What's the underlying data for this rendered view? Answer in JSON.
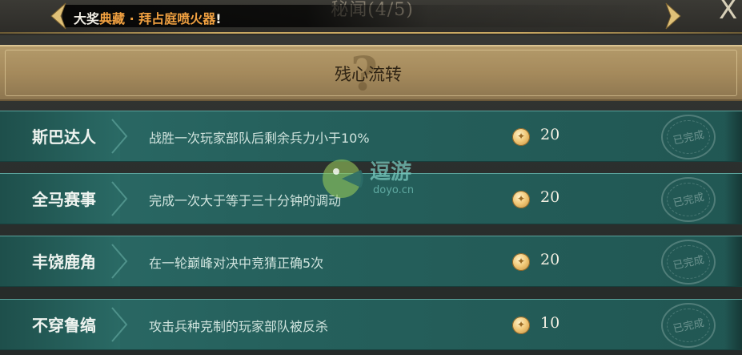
{
  "header": {
    "title": "秘闻(4/5)",
    "ticker": {
      "prefix": "大奖",
      "highlight": "典藏 · 拜占庭喷火器",
      "suffix": "!"
    },
    "close_label": "X"
  },
  "section": {
    "title": "残心流转",
    "icon": "question-mark-icon"
  },
  "quests": [
    {
      "name": "斯巴达人",
      "description": "战胜一次玩家部队后剩余兵力小于10%",
      "reward": "20",
      "status": "已完成"
    },
    {
      "name": "全马赛事",
      "description": "完成一次大于等于三十分钟的调动",
      "reward": "20",
      "status": "已完成"
    },
    {
      "name": "丰饶鹿角",
      "description": "在一轮巅峰对决中竞猜正确5次",
      "reward": "20",
      "status": "已完成"
    },
    {
      "name": "不穿鲁缟",
      "description": "攻击兵种克制的玩家部队被反杀",
      "reward": "10",
      "status": "已完成"
    }
  ],
  "watermark": {
    "title": "逗游",
    "subtitle": "doyo.cn"
  },
  "colors": {
    "row_teal": "#2c6b67",
    "gold": "#c9a862",
    "ticker_highlight": "#f0a040"
  }
}
